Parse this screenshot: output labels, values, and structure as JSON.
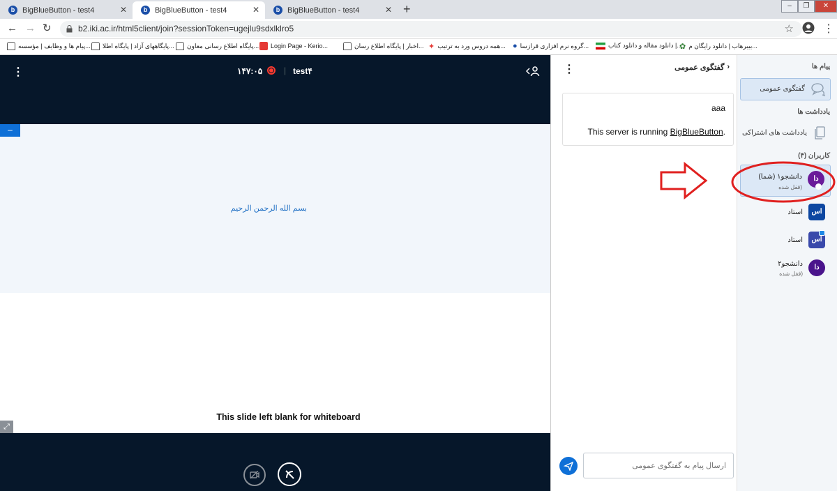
{
  "browser": {
    "tabs": [
      {
        "title": "BigBlueButton - test4",
        "active": false
      },
      {
        "title": "BigBlueButton - test4",
        "active": true
      },
      {
        "title": "BigBlueButton - test4",
        "active": false
      }
    ],
    "url": "b2.iki.ac.ir/html5client/join?sessionToken=ugejlu9sdxlklro5",
    "bookmarks": [
      "پیام ها و وظایف | مؤسسه...",
      "پایگاههای آزاد | پایگاه اطلا...",
      "پایگاه اطلاع رسانی معاون...",
      "Login Page - Kerio...",
      "اخبار | پایگاه اطلاع رسان...",
      "همه دروس ورد به ترتیب...",
      "گروه نرم افزاری قرازسا...",
      "دانلود مقاله و دانلود کتاب |...",
      "بیبرهاب | دانلود رایگان م..."
    ]
  },
  "meeting": {
    "title": "test۴",
    "timer": "۱۴۷:۰۵",
    "minimize_label": "–",
    "slide_text": "بسم الله الرحمن الرحیم",
    "slide_footer": "This slide left blank for whiteboard"
  },
  "chat": {
    "header": "گفتگوی عمومی",
    "messages": [
      {
        "text": "aaa"
      },
      {
        "text_prefix": "This server is running ",
        "link": "BigBlueButton",
        "text_suffix": "."
      }
    ],
    "input_placeholder": "ارسال پیام به گفتگوی عمومی"
  },
  "sidebar": {
    "messages_title": "پیام ها",
    "public_chat": "گفتگوی عمومی",
    "notes_title": "یادداشت ها",
    "shared_notes": "یادداشت های اشتراکی",
    "users_title": "کاربران (۴)",
    "users": [
      {
        "name": "دانشجو۱ (شما)",
        "status": "(قفل شده",
        "avatar": "دا",
        "color": "#6a1b9a",
        "shape": "circle"
      },
      {
        "name": "استاد",
        "status": "",
        "avatar": "اس",
        "color": "#0d47a1",
        "shape": "square"
      },
      {
        "name": "استاد",
        "status": "",
        "avatar": "اس",
        "color": "#3949ab",
        "shape": "square"
      },
      {
        "name": "دانشجو۲",
        "status": "(قفل شده",
        "avatar": "دا",
        "color": "#4a148c",
        "shape": "circle"
      }
    ]
  },
  "colors": {
    "dark_bg": "#06172a",
    "accent": "#0f70d7",
    "highlight": "#dce8f6",
    "annotation_red": "#e0201f"
  }
}
